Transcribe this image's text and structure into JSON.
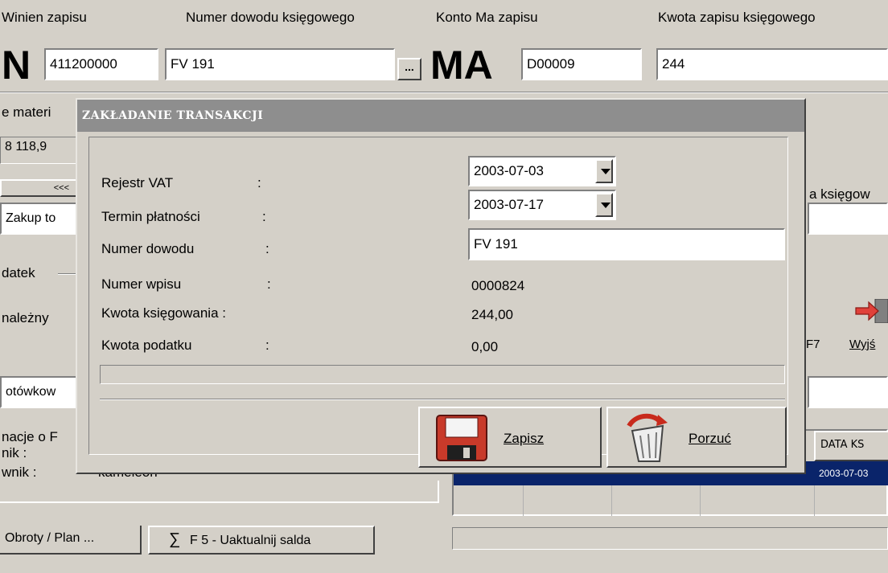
{
  "header": {
    "col_winien": "Winien  zapisu",
    "col_numer": "Numer dowodu księgowego",
    "col_konto": "Konto  Ma  zapisu",
    "col_kwota": "Kwota zapisu księgowego"
  },
  "entry": {
    "big_wn": "N",
    "account_wn": "411200000",
    "document_no": "FV 191",
    "browse_label": "...",
    "big_ma": "MA",
    "account_ma": "D00009",
    "amount": "244"
  },
  "background": {
    "left_label_1": "e materi",
    "left_value_1": "8 118,9",
    "left_nav": "<<<",
    "left_label_2": "Zakup to",
    "left_label_3": "datek",
    "left_label_4": "należny",
    "left_label_5": "otówkow",
    "left_label_6": "nacje o F",
    "left_label_7": "nik  :",
    "left_label_8": "wnik :",
    "left_value_8": "kameleon",
    "right_label_1": "a księgow",
    "right_f7": "F7",
    "right_exit": "Wyjś",
    "grid_header": "DATA KS",
    "grid_date": "2003-07-03",
    "bottom_tab_1": "Obroty / Plan ...",
    "bottom_tab_2_sigma": "∑",
    "bottom_tab_2": "F 5 -  Uaktualnij salda"
  },
  "dialog": {
    "title": "ZAKŁADANIE TRANSAKCJI",
    "rejestr_vat_label": "Rejestr VAT",
    "rejestr_vat_value": "2003-07-03",
    "termin_label": "Termin płatności",
    "termin_value": "2003-07-17",
    "numer_dowodu_label": "Numer dowodu",
    "numer_dowodu_value": "FV 191",
    "numer_wpisu_label": "Numer wpisu",
    "numer_wpisu_value": "0000824",
    "kwota_ksiegowania_label": "Kwota księgowania :",
    "kwota_ksiegowania_value": "244,00",
    "kwota_podatku_label": "Kwota podatku",
    "kwota_podatku_value": "0,00",
    "colon": ":",
    "save_label": "Zapisz",
    "cancel_label": "Porzuć"
  },
  "colors": {
    "window_bg": "#d4d0c8",
    "title_bar": "#8e8e8e",
    "selection": "#0a246a",
    "save_icon": "#c83a2a"
  },
  "icons": [
    "floppy-disk-icon",
    "trash-bin-icon",
    "exit-arrow-icon",
    "sigma-icon"
  ]
}
